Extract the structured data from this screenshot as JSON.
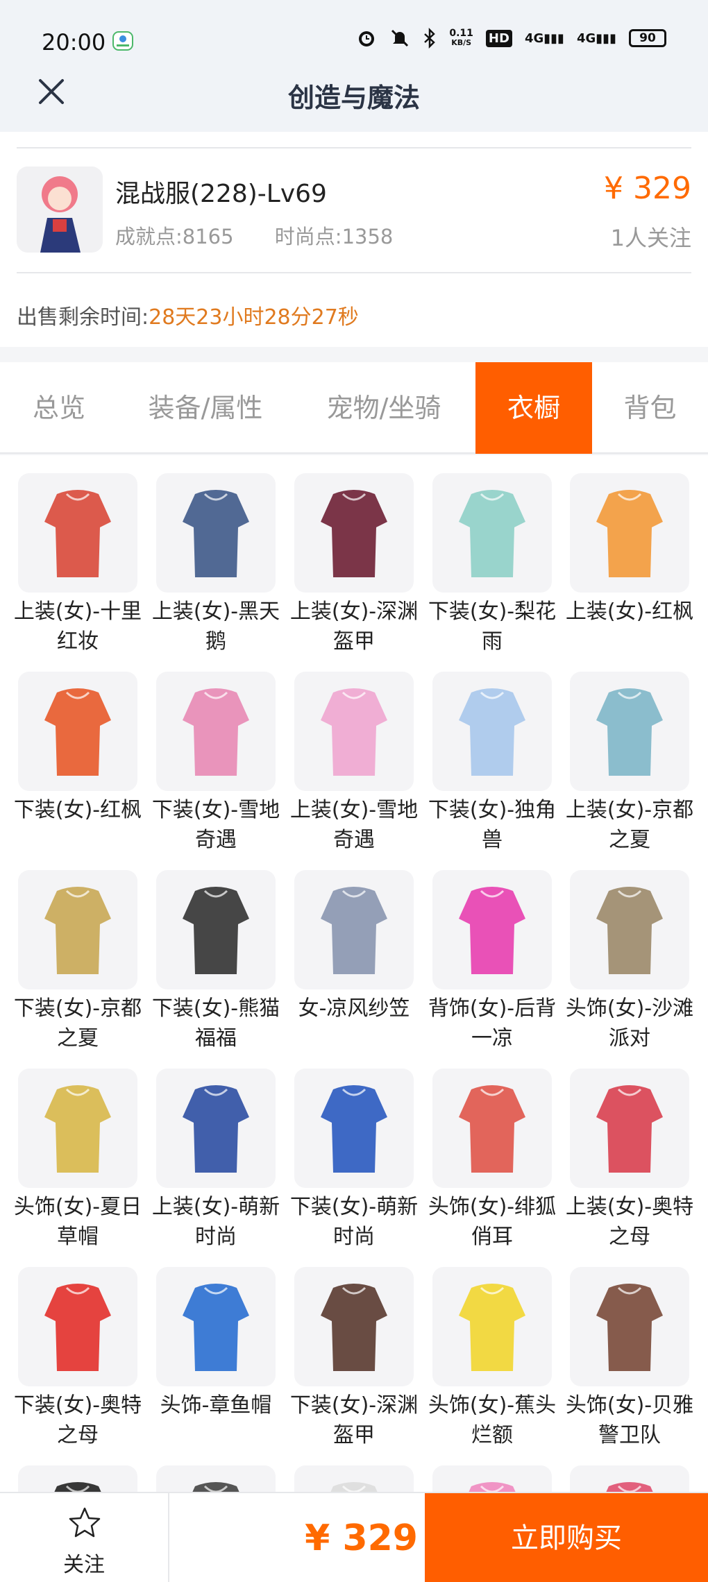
{
  "status_bar": {
    "time": "20:00",
    "net_speed_top": "0.11",
    "net_speed_unit": "KB/S",
    "hd": "HD",
    "signal_1": "4G",
    "signal_2": "4G",
    "battery": "90",
    "icons": [
      "app-badge-icon",
      "alarm-icon",
      "mute-icon",
      "bluetooth-icon",
      "hd-icon",
      "signal-icon",
      "battery-icon"
    ]
  },
  "nav": {
    "title": "创造与魔法"
  },
  "listing": {
    "server_name": "混战服(228)-Lv69",
    "achievement": "成就点:8165",
    "fashion": "时尚点:1358",
    "price": "¥ 329",
    "followers": "1人关注",
    "sale_label": "出售剩余时间:",
    "sale_time": "28天23小时28分27秒"
  },
  "tabs": [
    {
      "label": "总览",
      "active": false
    },
    {
      "label": "装备/属性",
      "active": false
    },
    {
      "label": "宠物/坐骑",
      "active": false
    },
    {
      "label": "衣橱",
      "active": true
    },
    {
      "label": "背包",
      "active": false
    }
  ],
  "wardrobe": [
    {
      "name": "上装(女)-十里红妆",
      "color": "#d9493a"
    },
    {
      "name": "上装(女)-黑天鹅",
      "color": "#3f5a8a"
    },
    {
      "name": "上装(女)-深渊盔甲",
      "color": "#6e2035"
    },
    {
      "name": "下装(女)-梨花雨",
      "color": "#8fd0c8"
    },
    {
      "name": "上装(女)-红枫",
      "color": "#f39a3a"
    },
    {
      "name": "下装(女)-红枫",
      "color": "#e85a2a"
    },
    {
      "name": "下装(女)-雪地奇遇",
      "color": "#e889b5"
    },
    {
      "name": "上装(女)-雪地奇遇",
      "color": "#f0a6d0"
    },
    {
      "name": "下装(女)-独角兽",
      "color": "#a9c8ec"
    },
    {
      "name": "上装(女)-京都之夏",
      "color": "#7fb7c9"
    },
    {
      "name": "下装(女)-京都之夏",
      "color": "#c9a955"
    },
    {
      "name": "下装(女)-熊猫福福",
      "color": "#333333"
    },
    {
      "name": "女-凉风纱笠",
      "color": "#8a96b0"
    },
    {
      "name": "背饰(女)-后背一凉",
      "color": "#e83fb0"
    },
    {
      "name": "头饰(女)-沙滩派对",
      "color": "#9c8a6a"
    },
    {
      "name": "头饰(女)-夏日草帽",
      "color": "#d8b84a"
    },
    {
      "name": "上装(女)-萌新时尚",
      "color": "#2d4fa3"
    },
    {
      "name": "下装(女)-萌新时尚",
      "color": "#2a5ac0"
    },
    {
      "name": "头饰(女)-绯狐俏耳",
      "color": "#e0554a"
    },
    {
      "name": "上装(女)-奥特之母",
      "color": "#d94050"
    },
    {
      "name": "下装(女)-奥特之母",
      "color": "#e3302b"
    },
    {
      "name": "头饰-章鱼帽",
      "color": "#2a6fd1"
    },
    {
      "name": "下装(女)-深渊盔甲",
      "color": "#5a3a30"
    },
    {
      "name": "头饰(女)-蕉头烂额",
      "color": "#f2d630"
    },
    {
      "name": "头饰(女)-贝雅警卫队",
      "color": "#7a4a3a"
    },
    {
      "name": "",
      "color": "#222222"
    },
    {
      "name": "",
      "color": "#444444"
    },
    {
      "name": "",
      "color": "#dddddd"
    },
    {
      "name": "",
      "color": "#f08ac0"
    },
    {
      "name": "",
      "color": "#e05070"
    }
  ],
  "bottom": {
    "follow_label": "关注",
    "price": "¥ 329",
    "buy_label": "立即购买"
  },
  "colors": {
    "accent": "#ff5e00",
    "price": "#ff6a00",
    "countdown": "#e07a1f"
  }
}
